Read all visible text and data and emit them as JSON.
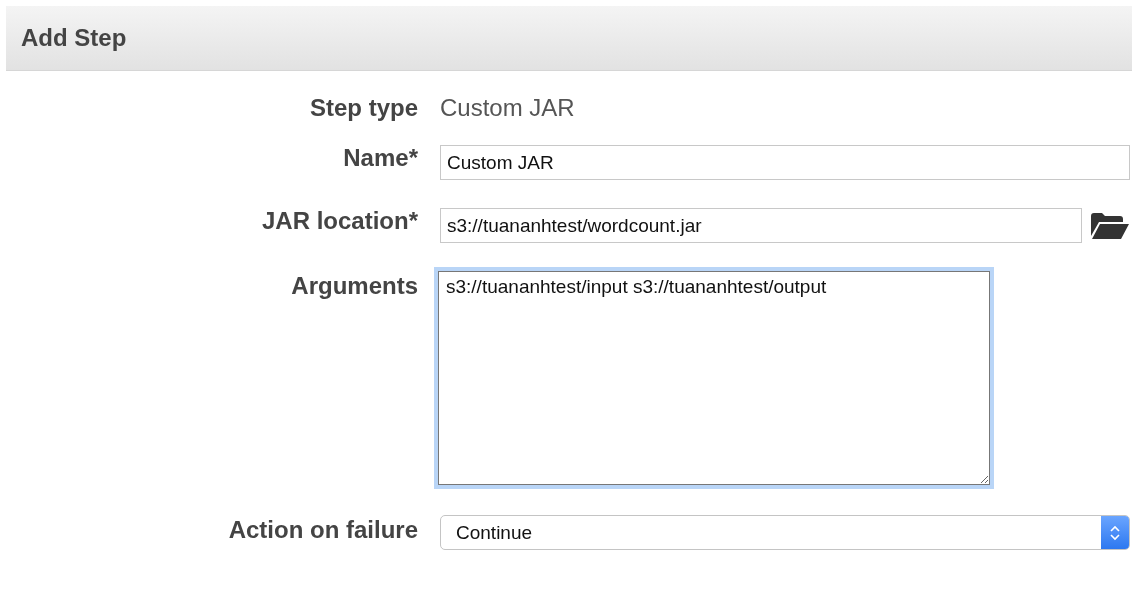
{
  "panel": {
    "title": "Add Step"
  },
  "fields": [
    {
      "kind": "static",
      "label": "Step type",
      "value": "Custom JAR"
    },
    {
      "kind": "input",
      "label": "Name*",
      "value": "Custom JAR"
    },
    {
      "kind": "browse",
      "label": "JAR location*",
      "value": "s3://tuananhtest/wordcount.jar"
    },
    {
      "kind": "textarea",
      "label": "Arguments",
      "value": "s3://tuananhtest/input s3://tuananhtest/output",
      "focused": true
    },
    {
      "kind": "select",
      "label": "Action on failure",
      "value": "Continue"
    }
  ]
}
